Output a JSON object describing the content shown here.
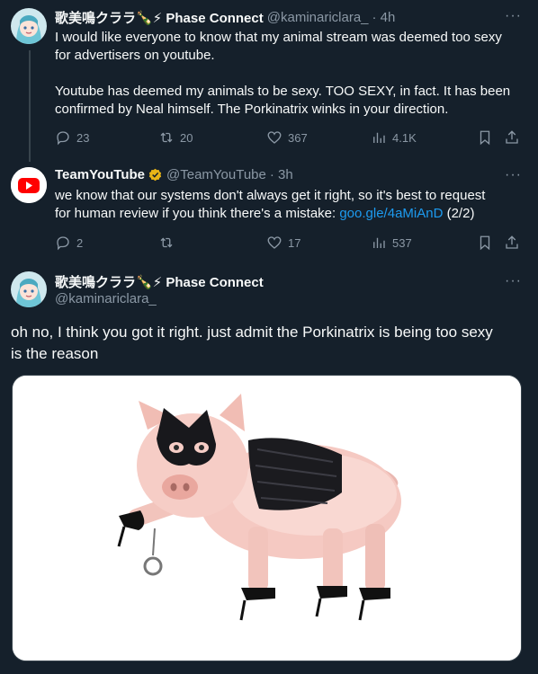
{
  "tweet1": {
    "display_name": "歌美鳴クララ🍾⚡ Phase Connect",
    "handle": "@kaminariclara_",
    "time": "· 4h",
    "more": "···",
    "line1": "I would like everyone to know that my animal stream was deemed too sexy",
    "line2": "for advertisers on youtube.",
    "line3": "Youtube has deemed my animals to be sexy. TOO SEXY, in fact. It has been",
    "line4": "confirmed by Neal himself. The Porkinatrix winks in your direction.",
    "replies": "23",
    "retweets": "20",
    "likes": "367",
    "views": "4.1K"
  },
  "tweet2": {
    "display_name": "TeamYouTube",
    "handle": "@TeamYouTube",
    "time": "· 3h",
    "more": "···",
    "line1": "we know that our systems don't always get it right, so it's best to request",
    "line2_pre": "for human review if you think there's a mistake:",
    "link": "goo.gle/4aMiAnD",
    "line2_post": "(2/2)",
    "replies": "2",
    "retweets": "",
    "likes": "17",
    "views": "537"
  },
  "tweet3": {
    "display_name": "歌美鳴クララ🍾⚡ Phase Connect",
    "handle": "@kaminariclara_",
    "more": "···",
    "line1": "oh no, I think you got it right. just admit the Porkinatrix is being too sexy",
    "line2": "is the reason"
  },
  "colors": {
    "background": "#15202b",
    "secondary_text": "#8b98a5",
    "link": "#1d9bf0",
    "verified_gold": "#e8b417",
    "youtube_red": "#ff0000"
  }
}
